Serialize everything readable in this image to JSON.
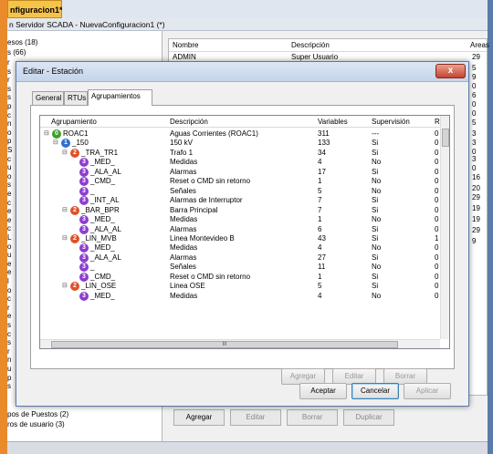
{
  "document_tab": "nfiguracion1*",
  "app_title": "n Servidor SCADA - NuevaConfiguracion1 (*)",
  "left_pane": {
    "top_items": [
      "esos (18)",
      "s (66)"
    ],
    "bottom_items": [
      "pos de Puestos (2)",
      "ros de usuario (3)"
    ],
    "clipped_letters": [
      "r",
      "s",
      "r",
      "s",
      "s",
      "p",
      "c",
      "n",
      "o",
      "p",
      "S",
      "c",
      "u",
      "o",
      "s",
      "e",
      "c",
      "e",
      "e",
      "c",
      "L",
      "o",
      "u",
      "e",
      "e",
      "l",
      "o",
      "c",
      "r",
      "e",
      "s",
      "c",
      "s",
      "r",
      "n",
      "u",
      "p",
      "s"
    ]
  },
  "grid": {
    "columns": [
      "Nombre",
      "Descripción",
      "Areas"
    ],
    "rows": [
      {
        "name": "ADMIN",
        "desc": "Super Usuario",
        "areas": "29"
      }
    ]
  },
  "right_numbers": [
    "5",
    "9",
    "0",
    "6",
    "0",
    "0",
    "5",
    "3",
    "3",
    "0",
    "3",
    "0",
    "16",
    "20",
    "29",
    "19",
    "19",
    "29",
    "9"
  ],
  "bottom_buttons": [
    "Agregar",
    "Editar",
    "Borrar",
    "Duplicar"
  ],
  "dialog": {
    "title": "Editar - Estación",
    "close": "x",
    "tabs": [
      "General",
      "RTUs",
      "Agrupamientos"
    ],
    "columns": {
      "agrupamiento": "Agrupamiento",
      "descripcion": "Descripción",
      "variables": "Variables",
      "supervision": "Supervisión",
      "r": "R"
    },
    "rows": [
      {
        "level": 0,
        "toggle": "⊟",
        "badge": "0",
        "name": "ROAC1",
        "desc": "Aguas Corrientes (ROAC1)",
        "vars": "311",
        "sup": "---",
        "r": "0"
      },
      {
        "level": 1,
        "toggle": "⊟",
        "badge": "1",
        "name": "_150",
        "desc": "150 kV",
        "vars": "133",
        "sup": "Si",
        "r": "0"
      },
      {
        "level": 2,
        "toggle": "⊟",
        "badge": "2",
        "name": "_TRA_TR1",
        "desc": "Trafo 1",
        "vars": "34",
        "sup": "Si",
        "r": "0"
      },
      {
        "level": 3,
        "toggle": "",
        "badge": "3",
        "name": "_MED_",
        "desc": "Medidas",
        "vars": "4",
        "sup": "No",
        "r": "0"
      },
      {
        "level": 3,
        "toggle": "",
        "badge": "3",
        "name": "_ALA_AL",
        "desc": "Alarmas",
        "vars": "17",
        "sup": "Si",
        "r": "0"
      },
      {
        "level": 3,
        "toggle": "",
        "badge": "3",
        "name": "_CMD_",
        "desc": "Reset o CMD sin retorno",
        "vars": "1",
        "sup": "No",
        "r": "0"
      },
      {
        "level": 3,
        "toggle": "",
        "badge": "3",
        "name": "_",
        "desc": "Señales",
        "vars": "5",
        "sup": "No",
        "r": "0"
      },
      {
        "level": 3,
        "toggle": "",
        "badge": "3",
        "name": "_INT_AL",
        "desc": "Alarmas de Interruptor",
        "vars": "7",
        "sup": "Si",
        "r": "0"
      },
      {
        "level": 2,
        "toggle": "⊟",
        "badge": "2",
        "name": "_BAR_BPR",
        "desc": "Barra Principal",
        "vars": "7",
        "sup": "Si",
        "r": "0"
      },
      {
        "level": 3,
        "toggle": "",
        "badge": "3",
        "name": "_MED_",
        "desc": "Medidas",
        "vars": "1",
        "sup": "No",
        "r": "0"
      },
      {
        "level": 3,
        "toggle": "",
        "badge": "3",
        "name": "_ALA_AL",
        "desc": "Alarmas",
        "vars": "6",
        "sup": "Si",
        "r": "0"
      },
      {
        "level": 2,
        "toggle": "⊟",
        "badge": "2",
        "name": "_LIN_MVB",
        "desc": "Linea Montevideo B",
        "vars": "43",
        "sup": "Si",
        "r": "1"
      },
      {
        "level": 3,
        "toggle": "",
        "badge": "3",
        "name": "_MED_",
        "desc": "Medidas",
        "vars": "4",
        "sup": "No",
        "r": "0"
      },
      {
        "level": 3,
        "toggle": "",
        "badge": "3",
        "name": "_ALA_AL",
        "desc": "Alarmas",
        "vars": "27",
        "sup": "Si",
        "r": "0"
      },
      {
        "level": 3,
        "toggle": "",
        "badge": "3",
        "name": "_",
        "desc": "Señales",
        "vars": "11",
        "sup": "No",
        "r": "0"
      },
      {
        "level": 3,
        "toggle": "",
        "badge": "3",
        "name": "_CMD_",
        "desc": "Reset o CMD sin retorno",
        "vars": "1",
        "sup": "Si",
        "r": "0"
      },
      {
        "level": 2,
        "toggle": "⊟",
        "badge": "2",
        "name": "_LIN_OSE",
        "desc": "Linea OSE",
        "vars": "5",
        "sup": "Si",
        "r": "0"
      },
      {
        "level": 3,
        "toggle": "",
        "badge": "3",
        "name": "_MED_",
        "desc": "Medidas",
        "vars": "4",
        "sup": "No",
        "r": "0"
      }
    ],
    "panel_buttons": [
      "Agregar",
      "Editar",
      "Borrar"
    ],
    "footer_buttons": [
      "Aceptar",
      "Cancelar",
      "Aplicar"
    ],
    "hscroll_grip": "III"
  }
}
